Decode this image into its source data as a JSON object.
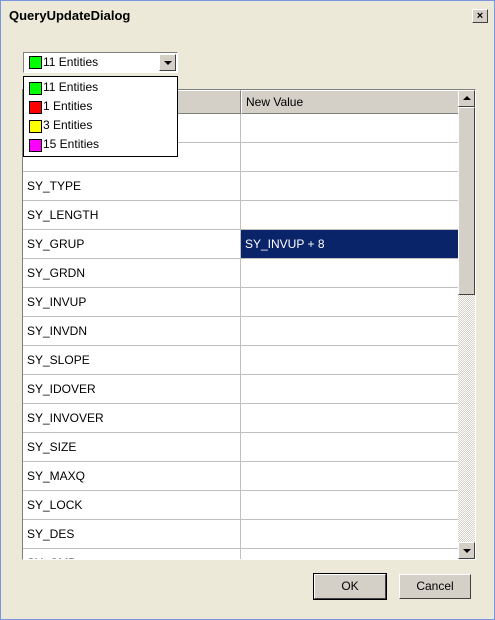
{
  "window": {
    "title": "QueryUpdateDialog",
    "close_label": "×"
  },
  "combo": {
    "selected_label": "11 Entities",
    "selected_color": "#00ff00"
  },
  "dropdown_items": [
    {
      "label": "11 Entities",
      "color": "#00ff00"
    },
    {
      "label": "1 Entities",
      "color": "#ff0000"
    },
    {
      "label": "3 Entities",
      "color": "#ffff00"
    },
    {
      "label": "15 Entities",
      "color": "#ff00ff"
    }
  ],
  "grid": {
    "columns": [
      "",
      "New Value"
    ],
    "rows": [
      {
        "name": "",
        "value": ""
      },
      {
        "name": "",
        "value": ""
      },
      {
        "name": "SY_TYPE",
        "value": ""
      },
      {
        "name": "SY_LENGTH",
        "value": ""
      },
      {
        "name": "SY_GRUP",
        "value": "SY_INVUP + 8"
      },
      {
        "name": "SY_GRDN",
        "value": ""
      },
      {
        "name": "SY_INVUP",
        "value": ""
      },
      {
        "name": "SY_INVDN",
        "value": ""
      },
      {
        "name": "SY_SLOPE",
        "value": ""
      },
      {
        "name": "SY_IDOVER",
        "value": ""
      },
      {
        "name": "SY_INVOVER",
        "value": ""
      },
      {
        "name": "SY_SIZE",
        "value": ""
      },
      {
        "name": "SY_MAXQ",
        "value": ""
      },
      {
        "name": "SY_LOCK",
        "value": ""
      },
      {
        "name": "SY_DES",
        "value": ""
      },
      {
        "name": "SY_CMD",
        "value": ""
      }
    ]
  },
  "buttons": {
    "ok": "OK",
    "cancel": "Cancel"
  }
}
